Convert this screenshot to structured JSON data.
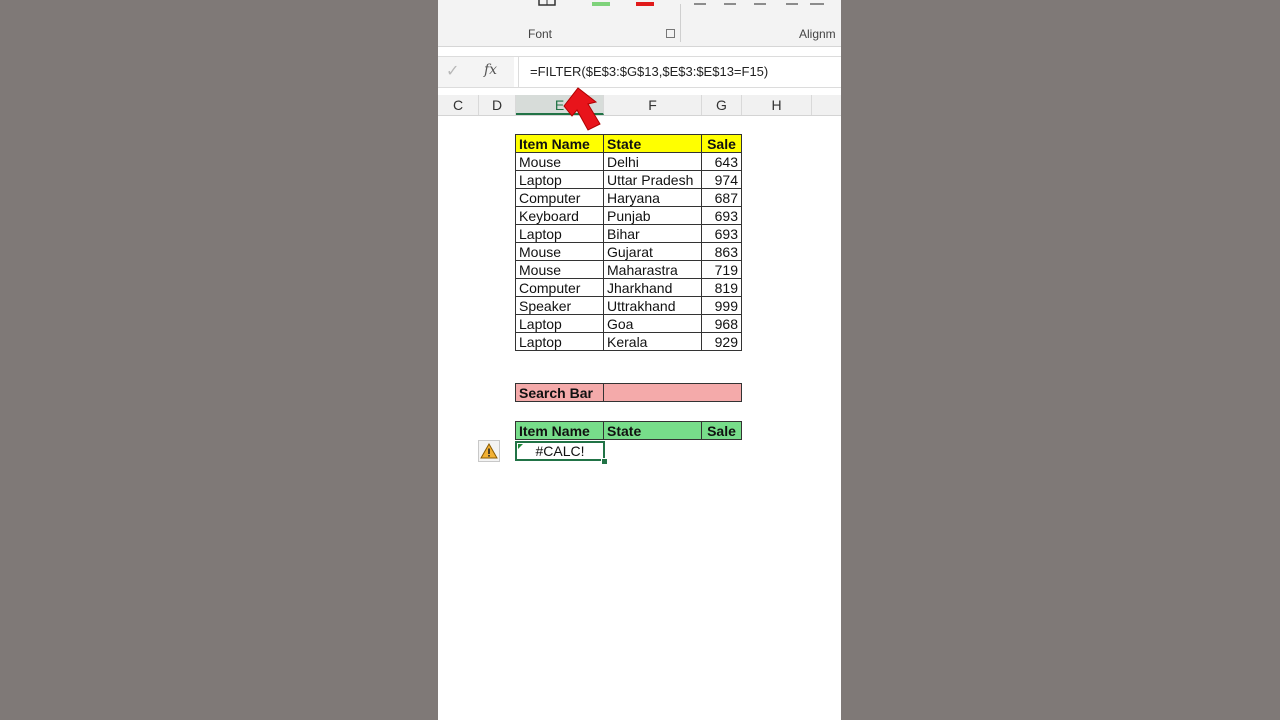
{
  "ribbon": {
    "font_label": "Font",
    "alignment_label": "Alignm"
  },
  "formula_bar": {
    "check_symbol": "✓",
    "fx_symbol": "fx",
    "formula": "=FILTER($E$3:$G$13,$E$3:$E$13=F15)"
  },
  "columns": [
    "C",
    "D",
    "E",
    "F",
    "G",
    "H"
  ],
  "data_table": {
    "headers": [
      "Item Name",
      "State",
      "Sale"
    ],
    "rows": [
      [
        "Mouse",
        "Delhi",
        "643"
      ],
      [
        "Laptop",
        "Uttar Pradesh",
        "974"
      ],
      [
        "Computer",
        "Haryana",
        "687"
      ],
      [
        "Keyboard",
        "Punjab",
        "693"
      ],
      [
        "Laptop",
        "Bihar",
        "693"
      ],
      [
        "Mouse",
        "Gujarat",
        "863"
      ],
      [
        "Mouse",
        "Maharastra",
        "719"
      ],
      [
        "Computer",
        "Jharkhand",
        "819"
      ],
      [
        "Speaker",
        "Uttrakhand",
        "999"
      ],
      [
        "Laptop",
        "Goa",
        "968"
      ],
      [
        "Laptop",
        "Kerala",
        "929"
      ]
    ]
  },
  "search": {
    "label": "Search Bar",
    "value": ""
  },
  "result_table": {
    "headers": [
      "Item Name",
      "State",
      "Sale"
    ],
    "error_value": "#CALC!"
  },
  "icons": {
    "warning": "warning-icon",
    "arrow": "red-arrow-pointer"
  },
  "colors": {
    "header_yellow": "#ffff00",
    "search_pink": "#f4aaaa",
    "result_green": "#77dd8a",
    "selection_green": "#217346",
    "arrow_red": "#e8141b"
  }
}
